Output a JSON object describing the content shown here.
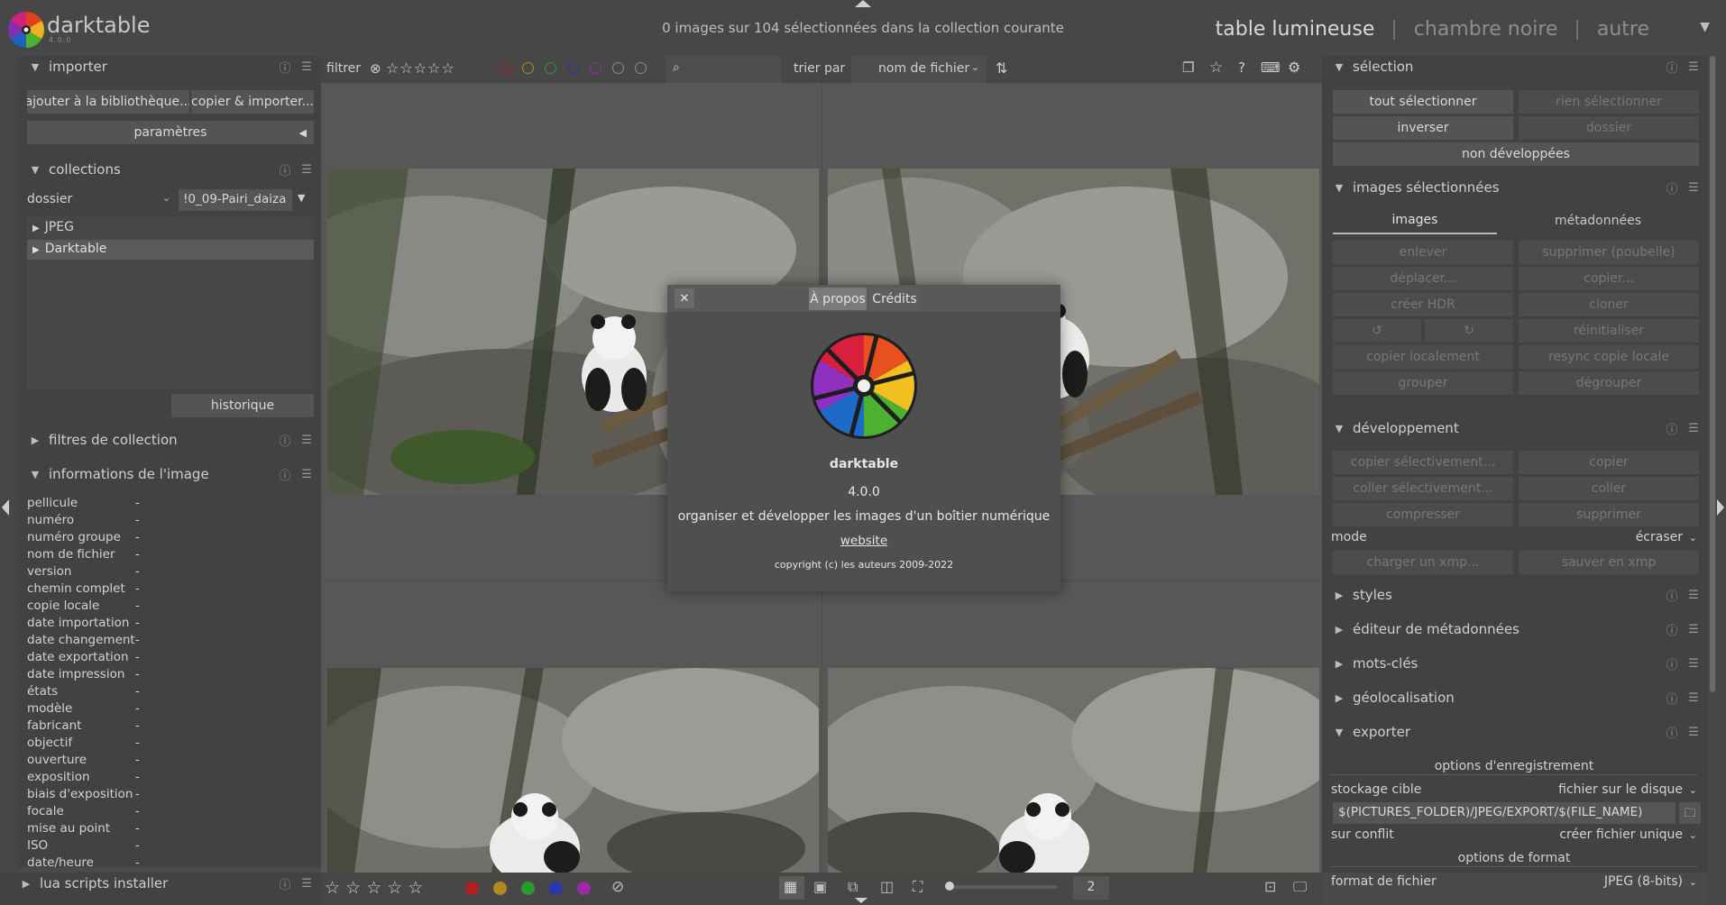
{
  "app": {
    "name": "darktable",
    "version_small": "4.0.0"
  },
  "header": {
    "collection_count": "0 images sur 104 sélectionnées dans la collection courante",
    "views": [
      "table lumineuse",
      "chambre noire",
      "autre"
    ],
    "separator": "|",
    "dropdown_glyph": "▼"
  },
  "left": {
    "importer": {
      "title": "importer",
      "add_button": "ajouter à la bibliothèque...",
      "copy_button": "copier & importer...",
      "params_button": "paramètres"
    },
    "collections": {
      "title": "collections",
      "label": "dossier",
      "value": "!0_09-Pairi_daiza",
      "items": [
        "JPEG",
        "Darktable"
      ],
      "history_button": "historique"
    },
    "filters": {
      "title": "filtres de collection"
    },
    "image_info": {
      "title": "informations de l'image",
      "rows": [
        {
          "k": "pellicule",
          "v": "-"
        },
        {
          "k": "numéro",
          "v": "-"
        },
        {
          "k": "numéro groupe",
          "v": "-"
        },
        {
          "k": "nom de fichier",
          "v": "-"
        },
        {
          "k": "version",
          "v": "-"
        },
        {
          "k": "chemin complet",
          "v": "-"
        },
        {
          "k": "copie locale",
          "v": "-"
        },
        {
          "k": "date importation",
          "v": "-"
        },
        {
          "k": "date changement",
          "v": "-"
        },
        {
          "k": "date exportation",
          "v": "-"
        },
        {
          "k": "date impression",
          "v": "-"
        },
        {
          "k": "états",
          "v": "-"
        },
        {
          "k": "modèle",
          "v": "-"
        },
        {
          "k": "fabricant",
          "v": "-"
        },
        {
          "k": "objectif",
          "v": "-"
        },
        {
          "k": "ouverture",
          "v": "-"
        },
        {
          "k": "exposition",
          "v": "-"
        },
        {
          "k": "biais d'exposition",
          "v": "-"
        },
        {
          "k": "focale",
          "v": "-"
        },
        {
          "k": "mise au point",
          "v": "-"
        },
        {
          "k": "ISO",
          "v": "-"
        },
        {
          "k": "date/heure",
          "v": "-"
        }
      ]
    },
    "lua": {
      "title": "lua scripts installer"
    }
  },
  "filterbar": {
    "filter_label": "filtrer",
    "sort_label": "trier par",
    "sort_value": "nom de fichier",
    "stars": "☆☆☆☆☆"
  },
  "bottombar": {
    "stars": "☆ ☆ ☆ ☆ ☆",
    "page_value": "2"
  },
  "colors": {
    "labels": [
      "#b02020",
      "#b08a20",
      "#2a9a2a",
      "#2a38b0",
      "#9a2aa8"
    ]
  },
  "right": {
    "selection": {
      "title": "sélection",
      "buttons": [
        "tout sélectionner",
        "rien sélectionner",
        "inverser",
        "dossier",
        "non développées"
      ]
    },
    "selected_images": {
      "title": "images sélectionnées",
      "tabs": [
        "images",
        "métadonnées"
      ],
      "buttons": [
        "enlever",
        "supprimer (poubelle)",
        "déplacer...",
        "copier...",
        "créer HDR",
        "cloner",
        "réinitialiser",
        "copier localement",
        "resync copie locale",
        "grouper",
        "dégrouper"
      ]
    },
    "develop": {
      "title": "développement",
      "buttons": [
        "copier sélectivement...",
        "copier",
        "coller sélectivement...",
        "coller",
        "compresser",
        "supprimer"
      ],
      "mode_label": "mode",
      "mode_value": "écraser",
      "xmp_buttons": [
        "charger un xmp...",
        "sauver en xmp"
      ]
    },
    "modules": [
      "styles",
      "éditeur de métadonnées",
      "mots-clés",
      "géolocalisation"
    ],
    "export": {
      "title": "exporter",
      "storage_options": "options d'enregistrement",
      "target_label": "stockage cible",
      "target_value": "fichier sur le disque",
      "path_value": "$(PICTURES_FOLDER)/JPEG/EXPORT/$(FILE_NAME)",
      "conflict_label": "sur conflit",
      "conflict_value": "créer fichier unique",
      "format_options": "options de format",
      "format_label": "format de fichier",
      "format_value": "JPEG (8-bits)"
    }
  },
  "dialog": {
    "tabs": [
      "À propos",
      "Crédits"
    ],
    "close_glyph": "✕",
    "name": "darktable",
    "version": "4.0.0",
    "description": "organiser et développer les images d'un boîtier numérique",
    "link": "website",
    "copyright": "copyright (c) les auteurs 2009-2022"
  }
}
